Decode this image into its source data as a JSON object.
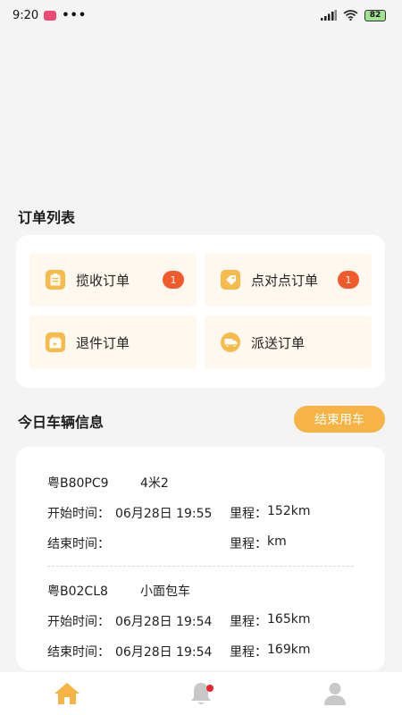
{
  "status_bar": {
    "time": "9:20",
    "dots": "•••",
    "battery": "82"
  },
  "orders": {
    "title": "订单列表",
    "items": [
      {
        "label": "揽收订单",
        "badge": "1",
        "icon": "clipboard-icon"
      },
      {
        "label": "点对点订单",
        "badge": "1",
        "icon": "tag-icon"
      },
      {
        "label": "退件订单",
        "badge": null,
        "icon": "return-box-icon"
      },
      {
        "label": "派送订单",
        "badge": null,
        "icon": "delivery-truck-icon"
      }
    ]
  },
  "vehicle": {
    "title": "今日车辆信息",
    "end_button": "结束用车",
    "start_label": "开始时间：",
    "end_label": "结束时间：",
    "mileage_label": "里程：",
    "records": [
      {
        "plate": "粤B80PC9",
        "type": "4米2",
        "start_time": "06月28日 19:55",
        "start_mileage": "152km",
        "end_time": "",
        "end_mileage": "km"
      },
      {
        "plate": "粤B02CL8",
        "type": "小面包车",
        "start_time": "06月28日 19:54",
        "start_mileage": "165km",
        "end_time": "06月28日 19:54",
        "end_mileage": "169km"
      }
    ]
  },
  "tabbar": {
    "items": [
      "home-icon",
      "bell-icon",
      "user-icon"
    ],
    "active_color": "#f7b345",
    "inactive_color": "#c8c8c8"
  }
}
